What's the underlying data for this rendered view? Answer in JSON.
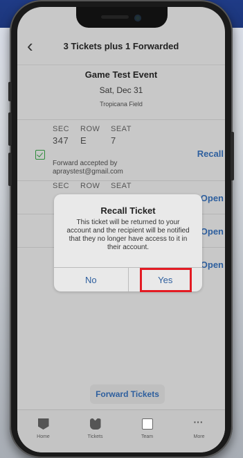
{
  "header": {
    "title": "3 Tickets plus 1 Forwarded",
    "back_icon": "chevron-left-icon"
  },
  "event": {
    "name": "Game Test Event",
    "date": "Sat, Dec 31",
    "venue": "Tropicana Field"
  },
  "tickets": [
    {
      "labels": [
        "SEC",
        "ROW",
        "SEAT"
      ],
      "values": [
        "347",
        "E",
        "7"
      ],
      "status": "Forward accepted by",
      "recipient": "apraystest@gmail.com",
      "action": "Recall"
    },
    {
      "labels": [
        "SEC",
        "ROW",
        "SEAT"
      ],
      "action": "Open"
    },
    {
      "action": "Open"
    },
    {
      "action": "Open"
    }
  ],
  "modal": {
    "title": "Recall Ticket",
    "body": "This ticket will be returned to your account and the recipient will be notified that they no longer have access to it in their account.",
    "no_label": "No",
    "yes_label": "Yes"
  },
  "footer": {
    "forward_label": "Forward Tickets"
  },
  "tabbar": [
    {
      "label": "Home",
      "icon": "home-icon"
    },
    {
      "label": "Tickets",
      "icon": "tickets-icon"
    },
    {
      "label": "Team",
      "icon": "team-icon"
    },
    {
      "label": "More",
      "icon": "more-icon"
    }
  ],
  "colors": {
    "accent": "#2e5f9e",
    "highlight": "#e31b23",
    "success": "#2d8a3a"
  }
}
